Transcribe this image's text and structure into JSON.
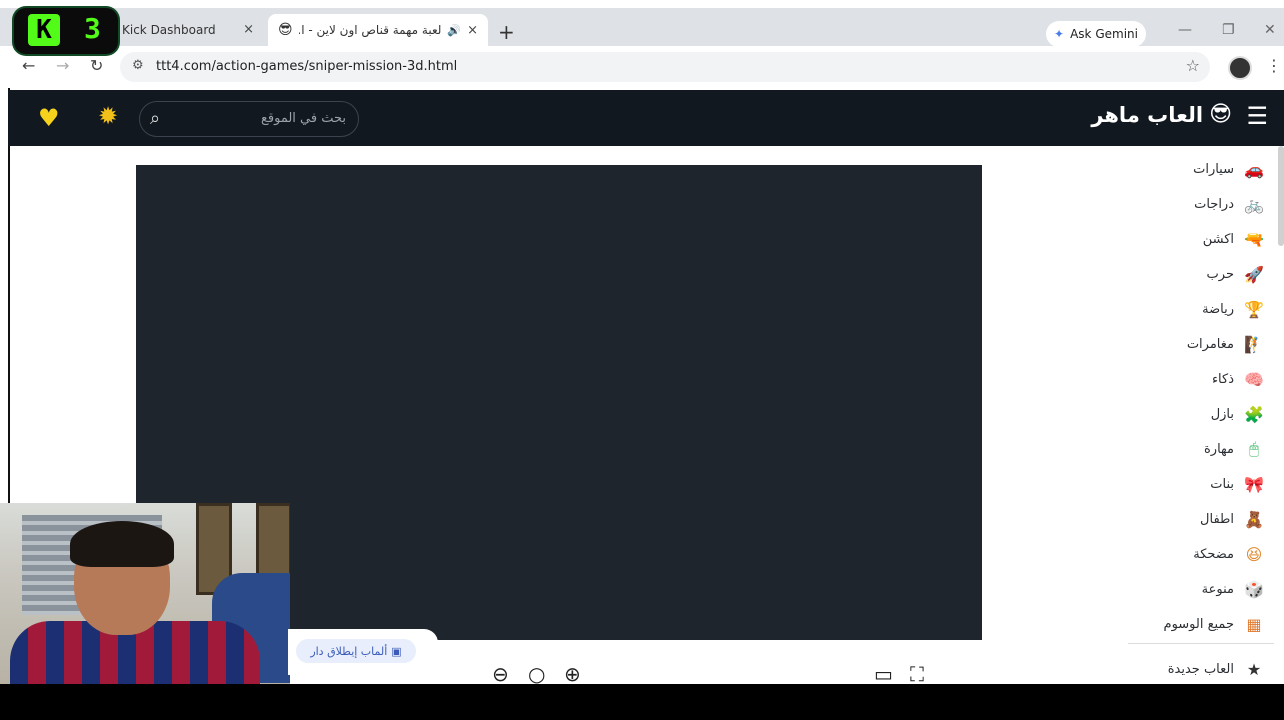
{
  "kick_overlay": {
    "logo_letter": "K",
    "count": "3"
  },
  "browser": {
    "tabs": [
      {
        "title": "Kick Dashboard",
        "close": "×"
      },
      {
        "title": "لعبة مهمة قناص اون لاين - ا...",
        "favicon": "😎",
        "audio_icon": "🔊",
        "close": "×"
      }
    ],
    "new_tab": "+",
    "ask_gemini": "Ask Gemini",
    "window_controls": [
      "—",
      "❐",
      "✕"
    ],
    "nav": {
      "back": "←",
      "forward": "→",
      "reload": "↻"
    },
    "url": "ttt4.com/action-games/sniper-mission-3d.html",
    "site_info_icon": "⚙",
    "bookmark_icon": "☆",
    "menu_icon": "⋮"
  },
  "site": {
    "logo_text": "العاب ماهر",
    "logo_emoji": "😎",
    "search_placeholder": "بحث في الموقع",
    "icons": {
      "heart": "♥",
      "sun": "✹",
      "search": "⌕",
      "hamburger": "☰"
    },
    "categories": [
      {
        "label": "سيارات",
        "icon": "🚗",
        "color": "#1fb4c4"
      },
      {
        "label": "دراجات",
        "icon": "🚲",
        "color": "#e0508a"
      },
      {
        "label": "اكشن",
        "icon": "🔫",
        "color": "#2fb35a"
      },
      {
        "label": "حرب",
        "icon": "🚀",
        "color": "#e0405a"
      },
      {
        "label": "رياضة",
        "icon": "🏆",
        "color": "#e0703a"
      },
      {
        "label": "مغامرات",
        "icon": "🧗",
        "color": "#e07a30"
      },
      {
        "label": "ذكاء",
        "icon": "🧠",
        "color": "#7a60d0"
      },
      {
        "label": "بازل",
        "icon": "🧩",
        "color": "#3a8ad8"
      },
      {
        "label": "مهارة",
        "icon": "🖱",
        "color": "#2fb35a"
      },
      {
        "label": "بنات",
        "icon": "🎀",
        "color": "#e0508a"
      },
      {
        "label": "اطفال",
        "icon": "🧸",
        "color": "#1fb4c4"
      },
      {
        "label": "مضحكة",
        "icon": "😆",
        "color": "#e08a30"
      },
      {
        "label": "منوعة",
        "icon": "🎲",
        "color": "#3a8ad8"
      },
      {
        "label": "جميع الوسوم",
        "icon": "▦",
        "color": "#e07a30"
      },
      {
        "label": "العاب جديدة",
        "icon": "★",
        "color": "#333333"
      }
    ]
  },
  "stream_tag": {
    "text": "ألماب إيطلاق دار",
    "icon": "▣"
  },
  "game_controls": {
    "zoom_out": "⊖",
    "zoom_reset": "○",
    "zoom_in": "⊕",
    "window": "▭",
    "fullscreen": "⛶"
  }
}
